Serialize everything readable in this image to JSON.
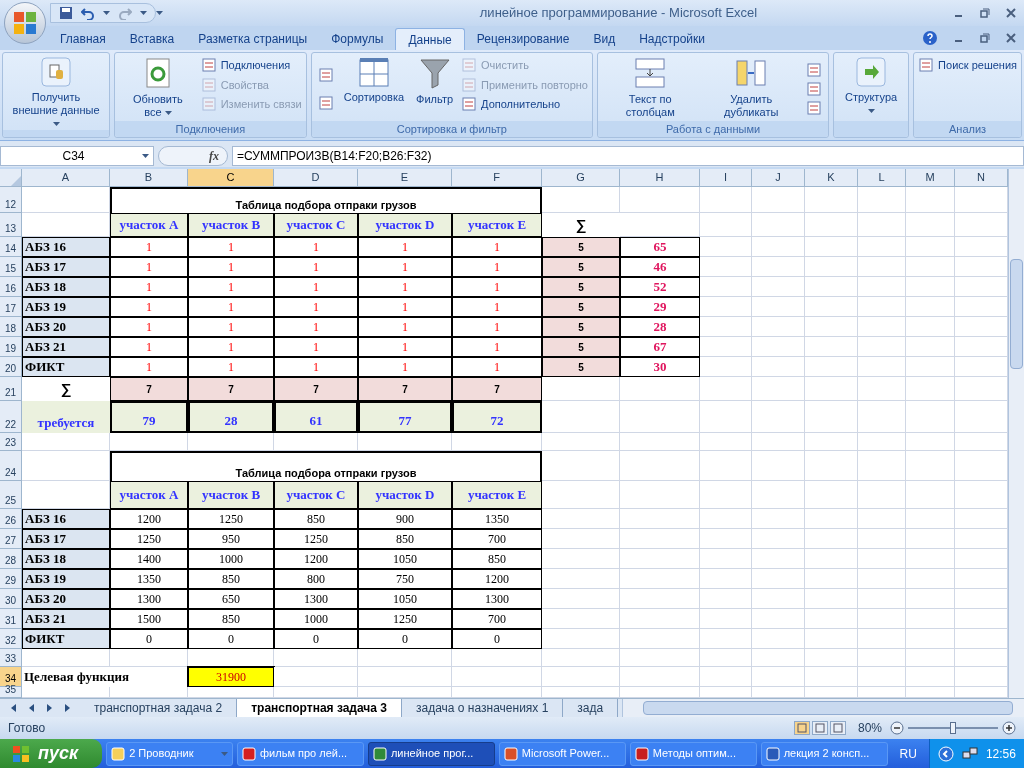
{
  "window": {
    "title": "линейное программирование - Microsoft Excel"
  },
  "ribbon_tabs": [
    {
      "label": "Главная",
      "selected": false
    },
    {
      "label": "Вставка",
      "selected": false
    },
    {
      "label": "Разметка страницы",
      "selected": false
    },
    {
      "label": "Формулы",
      "selected": false
    },
    {
      "label": "Данные",
      "selected": true
    },
    {
      "label": "Рецензирование",
      "selected": false
    },
    {
      "label": "Вид",
      "selected": false
    },
    {
      "label": "Надстройки",
      "selected": false
    }
  ],
  "ribbon_groups": [
    {
      "buttons": [
        {
          "kind": "large",
          "label": "Получить внешние данные",
          "menu": true,
          "disabled": false
        }
      ]
    },
    {
      "label": "Подключения",
      "buttons": [
        {
          "kind": "large",
          "label": "Обновить все",
          "menu": true,
          "disabled": false
        },
        {
          "kind": "small",
          "label": "Подключения",
          "disabled": false
        },
        {
          "kind": "small",
          "label": "Свойства",
          "disabled": true
        },
        {
          "kind": "small",
          "label": "Изменить связи",
          "disabled": true
        }
      ]
    },
    {
      "label": "Сортировка и фильтр",
      "buttons": [
        {
          "kind": "icon",
          "disabled": false
        },
        {
          "kind": "icon",
          "disabled": false
        },
        {
          "kind": "large",
          "label": "Сортировка",
          "menu": false,
          "disabled": false
        },
        {
          "kind": "large",
          "label": "Фильтр",
          "menu": false,
          "disabled": false
        },
        {
          "kind": "small",
          "label": "Очистить",
          "disabled": true
        },
        {
          "kind": "small",
          "label": "Применить повторно",
          "disabled": true
        },
        {
          "kind": "small",
          "label": "Дополнительно",
          "disabled": false
        }
      ]
    },
    {
      "label": "Работа с данными",
      "buttons": [
        {
          "kind": "large",
          "label": "Текст по столбцам",
          "menu": false,
          "disabled": false
        },
        {
          "kind": "large",
          "label": "Удалить дубликаты",
          "menu": false,
          "disabled": false
        },
        {
          "kind": "icon",
          "disabled": false
        },
        {
          "kind": "icon",
          "disabled": false
        },
        {
          "kind": "icon",
          "disabled": false
        }
      ]
    },
    {
      "buttons": [
        {
          "kind": "large",
          "label": "Структура",
          "menu": true,
          "disabled": false
        }
      ]
    },
    {
      "label": "Анализ",
      "buttons": [
        {
          "kind": "small",
          "label": "Поиск решения",
          "disabled": false
        }
      ]
    }
  ],
  "formula_bar": {
    "name_box": "C34",
    "function_label": "fx",
    "formula": "=СУММПРОИЗВ(B14:F20;B26:F32)"
  },
  "columns": [
    {
      "label": "A",
      "selected": false
    },
    {
      "label": "B",
      "selected": false
    },
    {
      "label": "C",
      "selected": true
    },
    {
      "label": "D",
      "selected": false
    },
    {
      "label": "E",
      "selected": false
    },
    {
      "label": "F",
      "selected": false
    },
    {
      "label": "G",
      "selected": false
    },
    {
      "label": "H",
      "selected": false
    },
    {
      "label": "I",
      "selected": false
    },
    {
      "label": "J",
      "selected": false
    },
    {
      "label": "K",
      "selected": false
    },
    {
      "label": "L",
      "selected": false
    },
    {
      "label": "M",
      "selected": false
    },
    {
      "label": "N",
      "selected": false
    }
  ],
  "rows": [
    {
      "number": "12",
      "selected": false,
      "cells": {
        "B": {
          "kind": "title",
          "text": "Таблица подбора отпраки грузов"
        }
      }
    },
    {
      "number": "13",
      "selected": false,
      "cells": {
        "B": {
          "kind": "header",
          "text": "участок A"
        },
        "C": {
          "kind": "header",
          "text": "участок B"
        },
        "D": {
          "kind": "header",
          "text": "участок C"
        },
        "E": {
          "kind": "header",
          "text": "участок D"
        },
        "F": {
          "kind": "header",
          "text": "участок E"
        },
        "G": {
          "kind": "sigma",
          "text": "∑"
        }
      }
    },
    {
      "number": "14",
      "selected": false,
      "cells": {
        "A": {
          "kind": "label",
          "text": "АБЗ 16"
        },
        "B": {
          "kind": "unit",
          "text": "1"
        },
        "C": {
          "kind": "unit",
          "text": "1"
        },
        "D": {
          "kind": "unit",
          "text": "1"
        },
        "E": {
          "kind": "unit",
          "text": "1"
        },
        "F": {
          "kind": "unit",
          "text": "1"
        },
        "G": {
          "kind": "sum",
          "text": "5"
        },
        "H": {
          "kind": "supply",
          "text": "65"
        }
      }
    },
    {
      "number": "15",
      "selected": false,
      "cells": {
        "A": {
          "kind": "label",
          "text": "АБЗ 17"
        },
        "B": {
          "kind": "unit",
          "text": "1"
        },
        "C": {
          "kind": "unit",
          "text": "1"
        },
        "D": {
          "kind": "unit",
          "text": "1"
        },
        "E": {
          "kind": "unit",
          "text": "1"
        },
        "F": {
          "kind": "unit",
          "text": "1"
        },
        "G": {
          "kind": "sum",
          "text": "5"
        },
        "H": {
          "kind": "supply",
          "text": "46"
        }
      }
    },
    {
      "number": "16",
      "selected": false,
      "cells": {
        "A": {
          "kind": "label",
          "text": "АБЗ 18"
        },
        "B": {
          "kind": "unit",
          "text": "1"
        },
        "C": {
          "kind": "unit",
          "text": "1"
        },
        "D": {
          "kind": "unit",
          "text": "1"
        },
        "E": {
          "kind": "unit",
          "text": "1"
        },
        "F": {
          "kind": "unit",
          "text": "1"
        },
        "G": {
          "kind": "sum",
          "text": "5"
        },
        "H": {
          "kind": "supply",
          "text": "52"
        }
      }
    },
    {
      "number": "17",
      "selected": false,
      "cells": {
        "A": {
          "kind": "label",
          "text": "АБЗ 19"
        },
        "B": {
          "kind": "unit",
          "text": "1"
        },
        "C": {
          "kind": "unit",
          "text": "1"
        },
        "D": {
          "kind": "unit",
          "text": "1"
        },
        "E": {
          "kind": "unit",
          "text": "1"
        },
        "F": {
          "kind": "unit",
          "text": "1"
        },
        "G": {
          "kind": "sum",
          "text": "5"
        },
        "H": {
          "kind": "supply",
          "text": "29"
        }
      }
    },
    {
      "number": "18",
      "selected": false,
      "cells": {
        "A": {
          "kind": "label",
          "text": "АБЗ 20"
        },
        "B": {
          "kind": "unit",
          "text": "1"
        },
        "C": {
          "kind": "unit",
          "text": "1"
        },
        "D": {
          "kind": "unit",
          "text": "1"
        },
        "E": {
          "kind": "unit",
          "text": "1"
        },
        "F": {
          "kind": "unit",
          "text": "1"
        },
        "G": {
          "kind": "sum",
          "text": "5"
        },
        "H": {
          "kind": "supply",
          "text": "28"
        }
      }
    },
    {
      "number": "19",
      "selected": false,
      "cells": {
        "A": {
          "kind": "label",
          "text": "АБЗ 21"
        },
        "B": {
          "kind": "unit",
          "text": "1"
        },
        "C": {
          "kind": "unit",
          "text": "1"
        },
        "D": {
          "kind": "unit",
          "text": "1"
        },
        "E": {
          "kind": "unit",
          "text": "1"
        },
        "F": {
          "kind": "unit",
          "text": "1"
        },
        "G": {
          "kind": "sum",
          "text": "5"
        },
        "H": {
          "kind": "supply",
          "text": "67"
        }
      }
    },
    {
      "number": "20",
      "selected": false,
      "cells": {
        "A": {
          "kind": "label",
          "text": "ФИКТ"
        },
        "B": {
          "kind": "unit",
          "text": "1"
        },
        "C": {
          "kind": "unit",
          "text": "1"
        },
        "D": {
          "kind": "unit",
          "text": "1"
        },
        "E": {
          "kind": "unit",
          "text": "1"
        },
        "F": {
          "kind": "unit",
          "text": "1"
        },
        "G": {
          "kind": "sum",
          "text": "5"
        },
        "H": {
          "kind": "supply",
          "text": "30"
        }
      }
    },
    {
      "number": "21",
      "selected": false,
      "cells": {
        "A": {
          "kind": "sigma",
          "text": "∑"
        },
        "B": {
          "kind": "sum",
          "text": "7"
        },
        "C": {
          "kind": "sum",
          "text": "7"
        },
        "D": {
          "kind": "sum",
          "text": "7"
        },
        "E": {
          "kind": "sum",
          "text": "7"
        },
        "F": {
          "kind": "sum",
          "text": "7"
        }
      }
    },
    {
      "number": "22",
      "selected": false,
      "cells": {
        "A": {
          "kind": "demand_label",
          "text": "требуется"
        },
        "B": {
          "kind": "demand",
          "text": "79"
        },
        "C": {
          "kind": "demand",
          "text": "28"
        },
        "D": {
          "kind": "demand",
          "text": "61"
        },
        "E": {
          "kind": "demand",
          "text": "77"
        },
        "F": {
          "kind": "demand",
          "text": "72"
        }
      }
    },
    {
      "number": "23",
      "selected": false,
      "cells": {}
    },
    {
      "number": "24",
      "selected": false,
      "cells": {
        "B": {
          "kind": "title",
          "text": "Таблица подбора отпраки грузов"
        }
      }
    },
    {
      "number": "25",
      "selected": false,
      "cells": {
        "B": {
          "kind": "header",
          "text": "участок A"
        },
        "C": {
          "kind": "header",
          "text": "участок B"
        },
        "D": {
          "kind": "header",
          "text": "участок C"
        },
        "E": {
          "kind": "header",
          "text": "участок D"
        },
        "F": {
          "kind": "header",
          "text": "участок E"
        }
      }
    },
    {
      "number": "26",
      "selected": false,
      "cells": {
        "A": {
          "kind": "label",
          "text": "АБЗ 16"
        },
        "B": {
          "kind": "cost",
          "text": "1200"
        },
        "C": {
          "kind": "cost",
          "text": "1250"
        },
        "D": {
          "kind": "cost",
          "text": "850"
        },
        "E": {
          "kind": "cost",
          "text": "900"
        },
        "F": {
          "kind": "cost",
          "text": "1350"
        }
      }
    },
    {
      "number": "27",
      "selected": false,
      "cells": {
        "A": {
          "kind": "label",
          "text": "АБЗ 17"
        },
        "B": {
          "kind": "cost",
          "text": "1250"
        },
        "C": {
          "kind": "cost",
          "text": "950"
        },
        "D": {
          "kind": "cost",
          "text": "1250"
        },
        "E": {
          "kind": "cost",
          "text": "850"
        },
        "F": {
          "kind": "cost",
          "text": "700"
        }
      }
    },
    {
      "number": "28",
      "selected": false,
      "cells": {
        "A": {
          "kind": "label",
          "text": "АБЗ 18"
        },
        "B": {
          "kind": "cost",
          "text": "1400"
        },
        "C": {
          "kind": "cost",
          "text": "1000"
        },
        "D": {
          "kind": "cost",
          "text": "1200"
        },
        "E": {
          "kind": "cost",
          "text": "1050"
        },
        "F": {
          "kind": "cost",
          "text": "850"
        }
      }
    },
    {
      "number": "29",
      "selected": false,
      "cells": {
        "A": {
          "kind": "label",
          "text": "АБЗ 19"
        },
        "B": {
          "kind": "cost",
          "text": "1350"
        },
        "C": {
          "kind": "cost",
          "text": "850"
        },
        "D": {
          "kind": "cost",
          "text": "800"
        },
        "E": {
          "kind": "cost",
          "text": "750"
        },
        "F": {
          "kind": "cost",
          "text": "1200"
        }
      }
    },
    {
      "number": "30",
      "selected": false,
      "cells": {
        "A": {
          "kind": "label",
          "text": "АБЗ 20"
        },
        "B": {
          "kind": "cost",
          "text": "1300"
        },
        "C": {
          "kind": "cost",
          "text": "650"
        },
        "D": {
          "kind": "cost",
          "text": "1300"
        },
        "E": {
          "kind": "cost",
          "text": "1050"
        },
        "F": {
          "kind": "cost",
          "text": "1300"
        }
      }
    },
    {
      "number": "31",
      "selected": false,
      "cells": {
        "A": {
          "kind": "label",
          "text": "АБЗ 21"
        },
        "B": {
          "kind": "cost",
          "text": "1500"
        },
        "C": {
          "kind": "cost",
          "text": "850"
        },
        "D": {
          "kind": "cost",
          "text": "1000"
        },
        "E": {
          "kind": "cost",
          "text": "1250"
        },
        "F": {
          "kind": "cost",
          "text": "700"
        }
      }
    },
    {
      "number": "32",
      "selected": false,
      "cells": {
        "A": {
          "kind": "label",
          "text": "ФИКТ"
        },
        "B": {
          "kind": "cost",
          "text": "0"
        },
        "C": {
          "kind": "cost",
          "text": "0"
        },
        "D": {
          "kind": "cost",
          "text": "0"
        },
        "E": {
          "kind": "cost",
          "text": "0"
        },
        "F": {
          "kind": "cost",
          "text": "0"
        }
      }
    },
    {
      "number": "33",
      "selected": false,
      "cells": {}
    },
    {
      "number": "34",
      "selected": true,
      "cells": {
        "A": {
          "kind": "objective_label",
          "text": "Целевая функция"
        },
        "C": {
          "kind": "objective",
          "text": "31900",
          "selected": true
        }
      }
    },
    {
      "number": "35",
      "selected": false,
      "cells": {}
    }
  ],
  "sheet_tabs": [
    {
      "label": "транспортная задача 2",
      "selected": false
    },
    {
      "label": "транспортная задача 3",
      "selected": true
    },
    {
      "label": "задача о назначениях 1",
      "selected": false
    },
    {
      "label": "зада",
      "selected": false
    }
  ],
  "status_bar": {
    "status": "Готово",
    "zoom": "80%",
    "zoom_level": {
      "level": 0.5
    }
  },
  "taskbar": {
    "start": "пуск",
    "items": [
      {
        "label": "2 Проводник",
        "menu": true,
        "selected": false
      },
      {
        "label": "фильм про лей...",
        "menu": false,
        "selected": false
      },
      {
        "label": "линейное прог...",
        "menu": false,
        "selected": true
      },
      {
        "label": "Microsoft Power...",
        "menu": false,
        "selected": false
      },
      {
        "label": "Методы оптим...",
        "menu": false,
        "selected": false
      },
      {
        "label": "лекция 2 консп...",
        "menu": false,
        "selected": false
      }
    ],
    "language": "RU",
    "clock": "12:56"
  }
}
